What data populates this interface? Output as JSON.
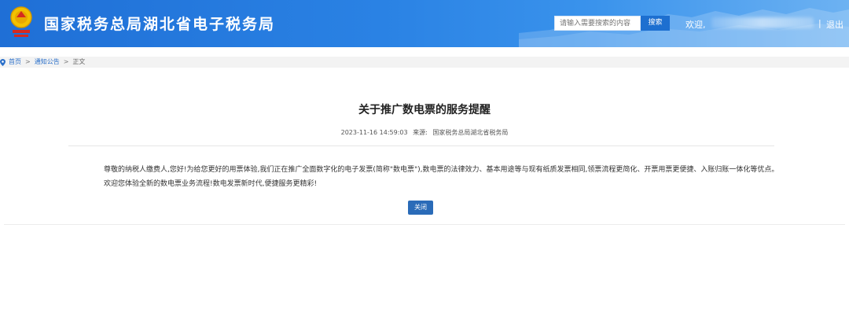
{
  "header": {
    "site_title": "国家税务总局湖北省电子税务局",
    "search_placeholder": "请输入需要搜索的内容",
    "search_label": "搜索",
    "welcome": "欢迎,",
    "separator": "|",
    "logout_label": "退出"
  },
  "breadcrumb": {
    "home": "首页",
    "section": "通知公告",
    "current": "正文",
    "separator": ">"
  },
  "article": {
    "title": "关于推广数电票的服务提醒",
    "datetime": "2023-11-16 14:59:03",
    "source_label": "来源:",
    "source": "国家税务总局湖北省税务局",
    "body": "尊敬的纳税人缴费人,您好!为给您更好的用票体验,我们正在推广全面数字化的电子发票(简称\"数电票\"),数电票的法律效力、基本用途等与现有纸质发票相同,领票流程更简化、开票用票更便捷、入账归账一体化等优点。欢迎您体验全新的数电票业务流程!数电发票新时代,便捷服务更精彩!",
    "close_label": "关闭"
  },
  "colors": {
    "header_blue": "#2a82e4",
    "button_blue": "#2a6bb8",
    "link_blue": "#2a6fc9"
  },
  "icons": {
    "emblem": "tax-emblem-icon",
    "breadcrumb": "location-pin-icon"
  }
}
